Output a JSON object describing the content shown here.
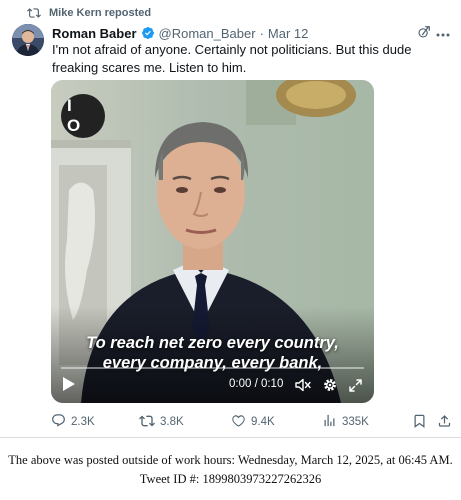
{
  "repost_banner": {
    "text": "Mike Kern reposted",
    "icon": "repost-icon"
  },
  "tweet": {
    "author_name": "Roman Baber",
    "handle": "@Roman_Baber",
    "separator": "·",
    "date": "Mar 12",
    "verified": true,
    "verified_color": "#1d9bf0",
    "text": "I'm not afraid of anyone. Certainly not politicians. But this dude freaking scares me. Listen to him."
  },
  "video": {
    "channel_logo": "I O",
    "caption_line1": "To reach net zero every country,",
    "caption_line2": "every company, every bank,",
    "timecode": "0:00 / 0:10",
    "progress": 0.0
  },
  "actions": {
    "replies": "2.3K",
    "reposts": "3.8K",
    "likes": "9.4K",
    "views": "335K"
  },
  "footer": {
    "line1": "The above was posted outside of work hours: Wednesday, March 12, 2025, at 06:45 AM.",
    "line2": "Tweet ID #: 1899803973227262326"
  },
  "colors": {
    "text": "#0f1419",
    "muted": "#536471",
    "accent": "#1d9bf0"
  }
}
